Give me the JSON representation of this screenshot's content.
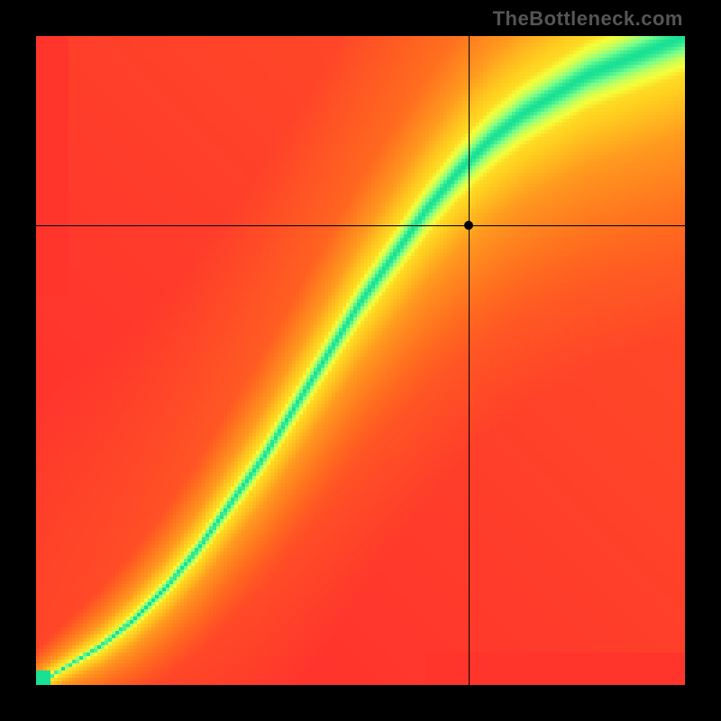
{
  "watermark": "TheBottleneck.com",
  "chart_data": {
    "type": "heatmap",
    "title": "",
    "xlabel": "",
    "ylabel": "",
    "xlim": [
      0,
      1
    ],
    "ylim": [
      0,
      1
    ],
    "grid_resolution": 180,
    "colormap": {
      "stops": [
        [
          0.0,
          "#ff1a33"
        ],
        [
          0.35,
          "#ff6a1f"
        ],
        [
          0.55,
          "#ff9a1f"
        ],
        [
          0.68,
          "#ffd21f"
        ],
        [
          0.8,
          "#f5ff3a"
        ],
        [
          0.88,
          "#c7ff5a"
        ],
        [
          0.94,
          "#7aff8a"
        ],
        [
          1.0,
          "#18e095"
        ]
      ]
    },
    "ridge": {
      "comment": "Green optimal band: y as a function of x; values normalized 0..1 with (0,0) at bottom-left.",
      "x": [
        0.0,
        0.05,
        0.1,
        0.15,
        0.2,
        0.25,
        0.3,
        0.35,
        0.4,
        0.45,
        0.5,
        0.55,
        0.6,
        0.65,
        0.7,
        0.75,
        0.8,
        0.85,
        0.9,
        0.95,
        1.0
      ],
      "y": [
        0.0,
        0.03,
        0.06,
        0.1,
        0.15,
        0.21,
        0.28,
        0.35,
        0.43,
        0.51,
        0.59,
        0.66,
        0.73,
        0.79,
        0.84,
        0.88,
        0.91,
        0.94,
        0.96,
        0.98,
        1.0
      ],
      "width": [
        0.005,
        0.008,
        0.012,
        0.016,
        0.02,
        0.024,
        0.028,
        0.032,
        0.036,
        0.04,
        0.044,
        0.048,
        0.052,
        0.056,
        0.06,
        0.062,
        0.064,
        0.066,
        0.068,
        0.07,
        0.072
      ]
    },
    "crosshair": {
      "x": 0.667,
      "y": 0.708
    },
    "marker": {
      "x": 0.667,
      "y": 0.708
    }
  }
}
